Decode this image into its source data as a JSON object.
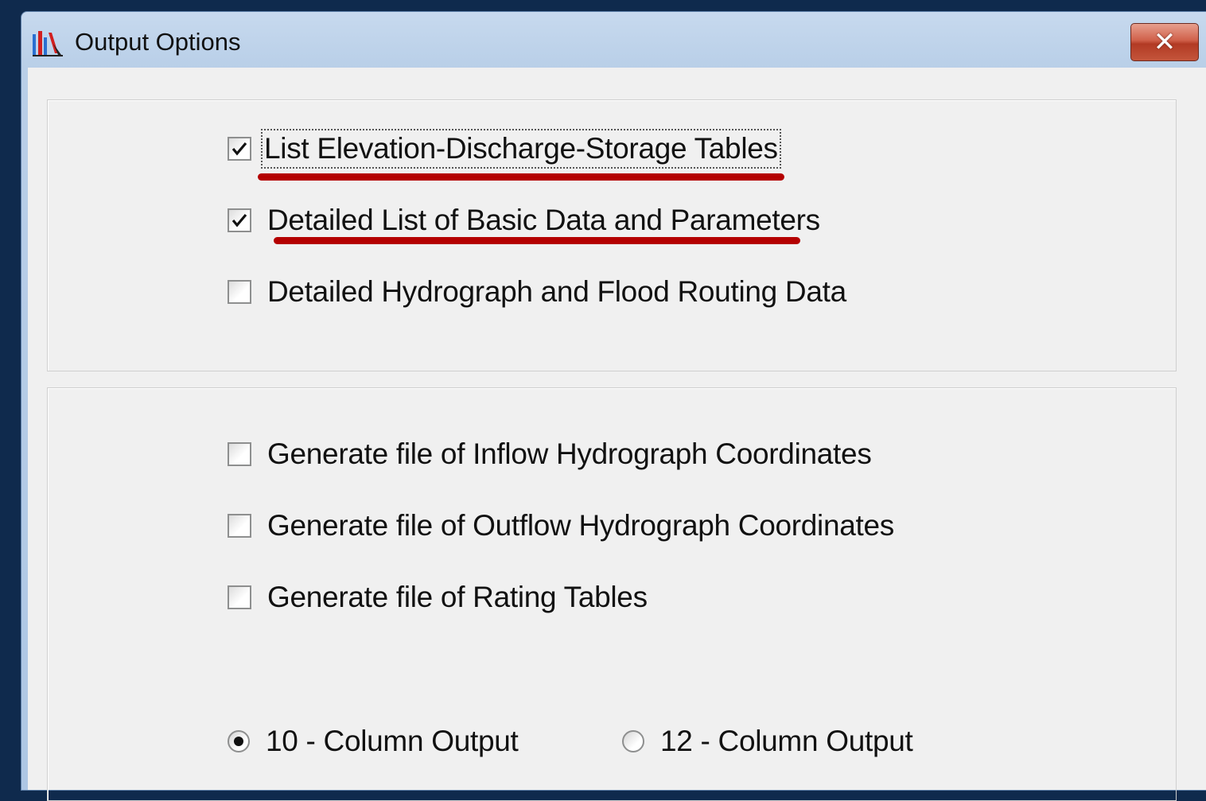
{
  "window": {
    "title": "Output Options",
    "close_label": "✕"
  },
  "output_group": {
    "options": [
      {
        "label": "List Elevation-Discharge-Storage Tables",
        "checked": true,
        "underlined": true
      },
      {
        "label": "Detailed List of Basic Data and Parameters",
        "checked": true,
        "underlined": true
      },
      {
        "label": "Detailed Hydrograph and Flood Routing Data",
        "checked": false,
        "underlined": false
      }
    ]
  },
  "file_group": {
    "options": [
      {
        "label": "Generate file of Inflow Hydrograph Coordinates",
        "checked": false
      },
      {
        "label": "Generate file of Outflow Hydrograph Coordinates",
        "checked": false
      },
      {
        "label": "Generate file of Rating Tables",
        "checked": false
      }
    ],
    "column_format": {
      "options": [
        {
          "label": "10 - Column Output",
          "selected": true
        },
        {
          "label": "12 - Column Output",
          "selected": false
        }
      ]
    }
  },
  "colors": {
    "annotation_underline": "#b40000",
    "desktop_background": "#0f2a4d"
  }
}
